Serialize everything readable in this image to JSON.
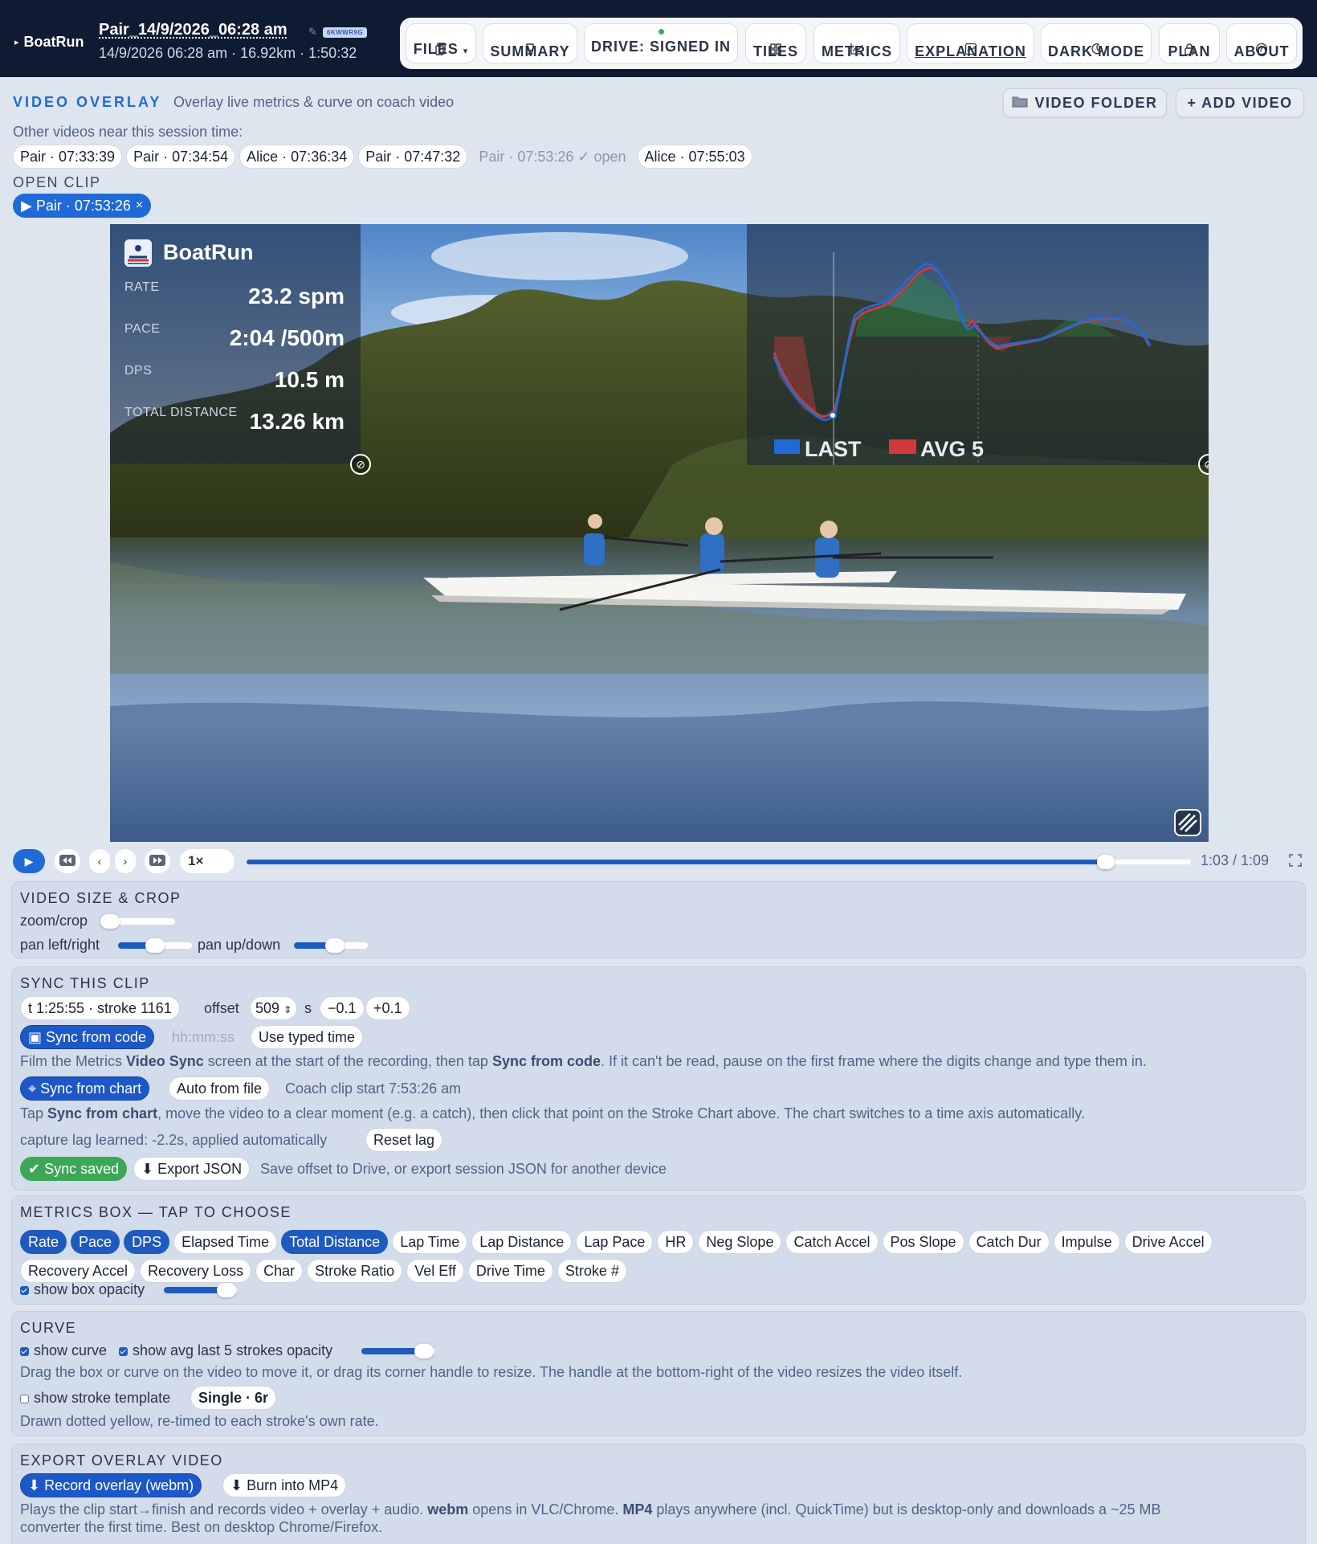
{
  "app": {
    "name": "BoatRun"
  },
  "session": {
    "title": "Pair_14/9/2026_06:28 am",
    "badge": "6KWWR9G",
    "subtitle": "14/9/2026 06:28 am · 16.92km · 1:50:32"
  },
  "nav": [
    {
      "label": "FILES",
      "caret": "▾",
      "icon": "files-icon"
    },
    {
      "label": "SUMMARY",
      "icon": "trophy-icon"
    },
    {
      "label": "DRIVE: SIGNED IN",
      "icon": "status-dot"
    },
    {
      "label": "TILES",
      "icon": "grid-icon"
    },
    {
      "label": "METRICS",
      "icon": "chart-icon"
    },
    {
      "label": "EXPLANATION",
      "icon": "graph-icon"
    },
    {
      "label": "DARK MODE",
      "icon": "moon-icon"
    },
    {
      "label": "PLAN",
      "icon": "lock-icon"
    },
    {
      "label": "ABOUT",
      "icon": "help-icon"
    }
  ],
  "overlay": {
    "title": "VIDEO OVERLAY",
    "subtitle": "Overlay live metrics & curve on coach video",
    "video_folder": "VIDEO FOLDER",
    "add_video": "+ ADD VIDEO",
    "other_label": "Other videos near this session time:",
    "other_videos": [
      "Pair · 07:33:39",
      "Pair · 07:34:54",
      "Alice · 07:36:34",
      "Pair · 07:47:32",
      "Pair · 07:53:26 ✓ open",
      "Alice · 07:55:03"
    ],
    "open_clip_label": "OPEN CLIP",
    "open_clip": "▶ Pair · 07:53:26",
    "open_clip_close": "×"
  },
  "video": {
    "brand": "BoatRun",
    "metrics": [
      {
        "label": "RATE",
        "value": "23.2 spm"
      },
      {
        "label": "PACE",
        "value": "2:04 /500m"
      },
      {
        "label": "DPS",
        "value": "10.5 m"
      },
      {
        "label": "TOTAL DISTANCE",
        "value": "13.26 km"
      }
    ],
    "legend": {
      "last": "LAST",
      "avg": "AVG 5",
      "last_color": "#1f6ad6",
      "avg_color": "#d03a3a"
    }
  },
  "player": {
    "speed": "1×",
    "time": "1:03 / 1:09",
    "progress": 0.91
  },
  "size_crop": {
    "title": "VIDEO SIZE & CROP",
    "zoom_label": "zoom/crop",
    "zoom_value": 0.12,
    "pan_lr_label": "pan left/right",
    "pan_lr_value": 0.5,
    "pan_ud_label": "pan up/down",
    "pan_ud_value": 0.55
  },
  "sync": {
    "title": "SYNC THIS CLIP",
    "stroke_info": "t 1:25:55 · stroke 1161",
    "offset_label": "offset",
    "offset_value": "509",
    "offset_unit": "s",
    "minus": "−0.1",
    "plus": "+0.1",
    "sync_code": "▣ Sync from code",
    "time_placeholder": "hh:mm:ss",
    "use_typed": "Use typed time",
    "help1_a": "Film the Metrics ",
    "help1_b": "Video Sync",
    "help1_c": " screen at the start of the recording, then tap ",
    "help1_d": "Sync from code",
    "help1_e": ". If it can't be read, pause on the first frame where the digits change and type them in.",
    "sync_chart": "⌖ Sync from chart",
    "auto_file": "Auto from file",
    "coach_start": "Coach clip start 7:53:26 am",
    "help2_a": "Tap ",
    "help2_b": "Sync from chart",
    "help2_c": ", move the video to a clear moment (e.g. a catch), then click that point on the Stroke Chart above. The chart switches to a time axis automatically.",
    "lag_text": "capture lag learned: -2.2s, applied automatically",
    "reset_lag": "Reset lag",
    "saved": "✔ Sync saved",
    "export_json": "⬇ Export JSON",
    "save_help": "Save offset to Drive, or export session JSON for another device"
  },
  "metrics_box": {
    "title": "METRICS BOX — TAP TO CHOOSE",
    "chips": [
      {
        "label": "Rate",
        "on": true
      },
      {
        "label": "Pace",
        "on": true
      },
      {
        "label": "DPS",
        "on": true
      },
      {
        "label": "Elapsed Time",
        "on": false
      },
      {
        "label": "Total Distance",
        "on": true
      },
      {
        "label": "Lap Time",
        "on": false
      },
      {
        "label": "Lap Distance",
        "on": false
      },
      {
        "label": "Lap Pace",
        "on": false
      },
      {
        "label": "HR",
        "on": false
      },
      {
        "label": "Neg Slope",
        "on": false
      },
      {
        "label": "Catch Accel",
        "on": false
      },
      {
        "label": "Pos Slope",
        "on": false
      },
      {
        "label": "Catch Dur",
        "on": false
      },
      {
        "label": "Impulse",
        "on": false
      },
      {
        "label": "Drive Accel",
        "on": false
      },
      {
        "label": "Recovery Accel",
        "on": false
      },
      {
        "label": "Recovery Loss",
        "on": false
      },
      {
        "label": "Char",
        "on": false
      },
      {
        "label": "Stroke Ratio",
        "on": false
      },
      {
        "label": "Vel Eff",
        "on": false
      },
      {
        "label": "Drive Time",
        "on": false
      },
      {
        "label": "Stroke #",
        "on": false
      }
    ],
    "show_box_label": "show box opacity",
    "show_box_checked": true,
    "opacity_value": 0.85
  },
  "curve": {
    "title": "CURVE",
    "show_curve": "show curve",
    "show_avg": "show avg last 5 strokes opacity",
    "avg_opacity": 0.85,
    "help1": "Drag the box or curve on the video to move it, or drag its corner handle to resize. The handle at the bottom-right of the video resizes the video itself.",
    "show_template": "show stroke template",
    "template_value": "Single · 6r",
    "help2": "Drawn dotted yellow, re-timed to each stroke's own rate."
  },
  "export": {
    "title": "EXPORT OVERLAY VIDEO",
    "record": "⬇ Record overlay (webm)",
    "burn": "⬇ Burn into MP4",
    "help1_a": "Plays the clip start→finish and records video + overlay + audio. ",
    "help1_b": "webm",
    "help1_c": " opens in VLC/Chrome. ",
    "help1_d": "MP4",
    "help1_e": " plays anywhere (incl. QuickTime) but is desktop-only and downloads a ~25 MB",
    "help2": "converter the first time. Best on desktop Chrome/Firefox."
  }
}
